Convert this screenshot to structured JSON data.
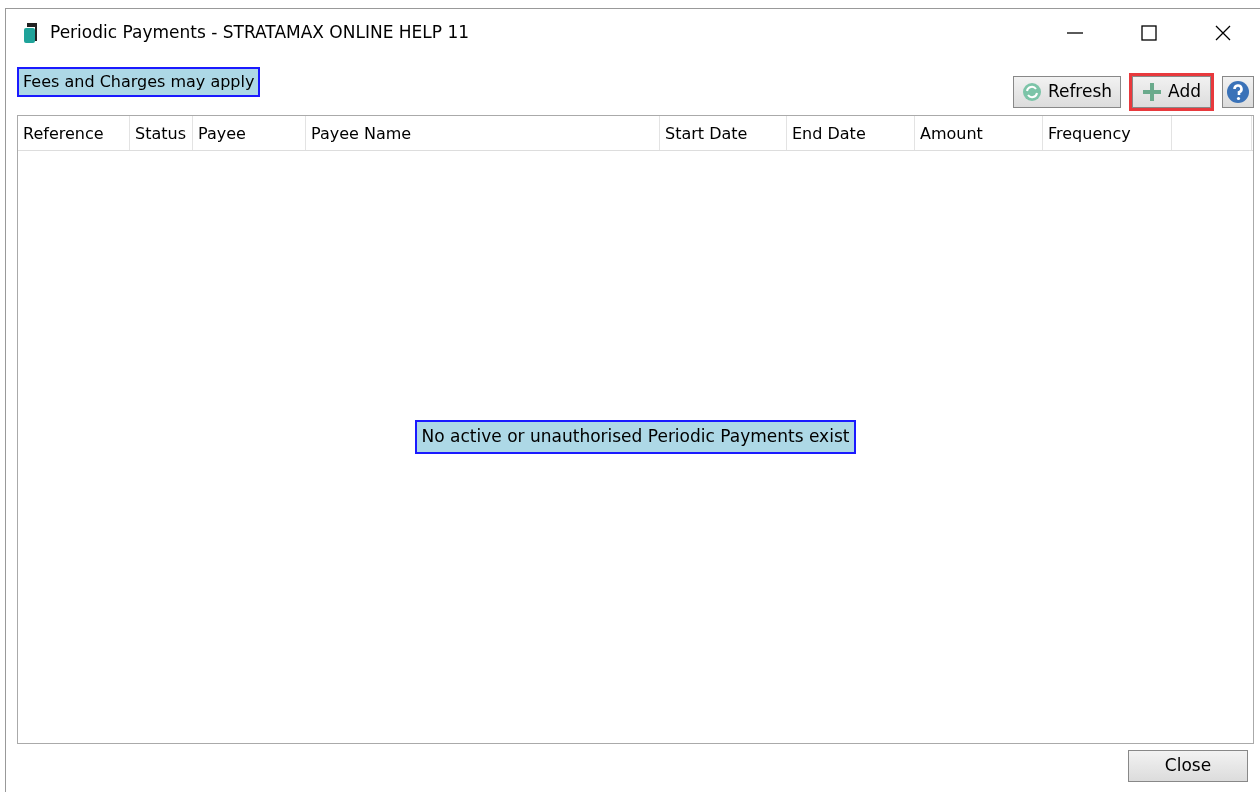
{
  "window": {
    "title": "Periodic Payments - STRATAMAX ONLINE HELP 11"
  },
  "notice": "Fees and Charges may apply",
  "toolbar": [
    {
      "kind": "refresh",
      "label": "Refresh",
      "highlighted": false
    },
    {
      "kind": "add",
      "label": "Add",
      "highlighted": true
    },
    {
      "kind": "help",
      "highlighted": false
    }
  ],
  "table": {
    "columns": [
      "Reference",
      "Status",
      "Payee",
      "Payee Name",
      "Start Date",
      "End Date",
      "Amount",
      "Frequency",
      ""
    ],
    "empty_message": "No active or unauthorised Periodic Payments exist"
  },
  "buttons": [
    "Close"
  ]
}
